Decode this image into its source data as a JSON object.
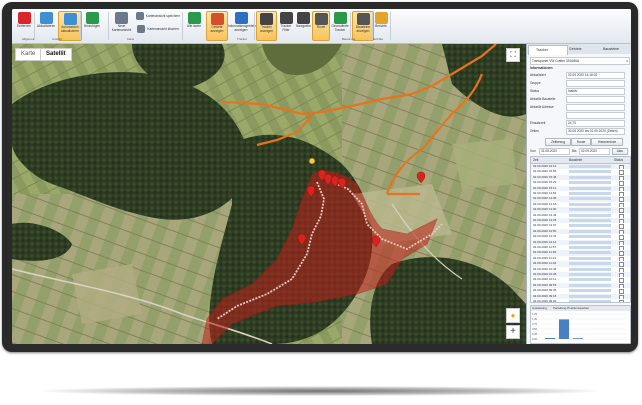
{
  "ribbon": {
    "buttons": [
      {
        "label": "Entfernen",
        "icon": "close-icon",
        "color": "#d8262b",
        "active": false
      },
      {
        "label": "Aktualisieren",
        "icon": "refresh-icon",
        "color": "#3f8fd2",
        "active": false
      },
      {
        "label": "Automatisch aktualisieren",
        "icon": "auto-refresh-icon",
        "color": "#3f8fd2",
        "active": true
      },
      {
        "label": "Hinzufügen",
        "icon": "globe-icon",
        "color": "#2a9a4a",
        "active": false
      },
      {
        "label": "Neue Kartenansicht",
        "icon": "map-view-icon",
        "color": "#6a7a8a",
        "active": false
      },
      {
        "label": "Kartenansicht speichern",
        "icon": "save-view-icon",
        "color": "#6a7a8a",
        "active": false
      },
      {
        "label": "Kartenansicht löschen",
        "icon": "delete-view-icon",
        "color": "#6a7a8a",
        "active": false
      },
      {
        "label": "Alle laden",
        "icon": "globe-small-icon",
        "color": "#2a9a4a",
        "active": false
      },
      {
        "label": "Gebiete anzeigen",
        "icon": "area-icon",
        "color": "#d4502b",
        "active": true
      },
      {
        "label": "Informationsgebiete anzeigen",
        "icon": "info-icon",
        "color": "#2f6fc1",
        "active": false
      },
      {
        "label": "Tracker anzeigen",
        "icon": "tracker-icon",
        "color": "#444444",
        "active": true
      },
      {
        "label": "Tracker Filter",
        "icon": "filter-icon",
        "color": "#444444",
        "active": false
      },
      {
        "label": "Navigation",
        "icon": "navigation-icon",
        "color": "#444444",
        "active": false
      },
      {
        "label": "Route",
        "icon": "route-icon",
        "color": "#555555",
        "active": true
      },
      {
        "label": "Geocodierte Tracker",
        "icon": "geocode-icon",
        "color": "#2a9a4a",
        "active": false
      },
      {
        "label": "Bausteine anzeigen",
        "icon": "blocks-icon",
        "color": "#555555",
        "active": true
      },
      {
        "label": "Berichte",
        "icon": "report-icon",
        "color": "#e2a42a",
        "active": false
      }
    ],
    "groups": [
      "Allgemein",
      "Ansicht",
      "Karte",
      "Tracker",
      "Bausteine",
      "Berichte"
    ]
  },
  "map": {
    "mode_buttons": [
      "Karte",
      "Satellit"
    ],
    "active_mode": "Satellit"
  },
  "panel": {
    "tabs": [
      "Tracker",
      "Gebiete",
      "Bausteine"
    ],
    "selected_tracker": "Transporter VW Crafter 3S1686A",
    "section_title": "Informationen",
    "fields": [
      {
        "label": "Aktualisiert",
        "value": "02.09.2020 14:18:02"
      },
      {
        "label": "Gruppe",
        "value": ""
      },
      {
        "label": "Status",
        "value": "Inaktiv"
      },
      {
        "label": "Aktuelle Baustelle",
        "value": ""
      },
      {
        "label": "Aktuelle Adresse",
        "value": ""
      },
      {
        "label": "",
        "value": ""
      },
      {
        "label": "Einsatzzeit",
        "value": "24,70"
      },
      {
        "label": "Zeiten",
        "value": "30.08.2020 bis 02.09.2020 (Zeiten)"
      }
    ],
    "action_buttons": [
      "Zeitbezug",
      "Route",
      "Historienlinie"
    ],
    "date_from_label": "Von",
    "date_from": "31.08.2020",
    "date_to_label": "Bis",
    "date_to": "02.09.2020",
    "date_apply": "Aktu",
    "table": {
      "headers": [
        "Zeit",
        "Baustelle",
        "Status"
      ],
      "rows": [
        "02.09.2020 16:14",
        "02.09.2020 15:56",
        "02.09.2020 15:46",
        "02.09.2020 15:29",
        "02.09.2020 15:11",
        "02.09.2020 14:53",
        "02.09.2020 14:36",
        "02.09.2020 14:18",
        "02.09.2020 14:00",
        "02.09.2020 13:43",
        "02.09.2020 13:25",
        "02.09.2020 13:07",
        "02.09.2020 12:50",
        "02.09.2020 12:32",
        "02.09.2020 12:14",
        "02.09.2020 11:57",
        "02.09.2020 11:39",
        "02.09.2020 11:21",
        "02.09.2020 11:04",
        "02.09.2020 10:46",
        "02.09.2020 10:28",
        "02.09.2020 10:11",
        "02.09.2020 09:53",
        "02.09.2020 09:35",
        "02.09.2020 09:18",
        "02.09.2020 09:00"
      ]
    },
    "chart_tabs": [
      "Auslastung",
      "Verteilung Positionsquellen"
    ],
    "chart": {
      "yticks": [
        "1,25",
        "1,00",
        "0,75",
        "0,50",
        "0,25",
        "0,00"
      ],
      "bars": [
        0.05,
        0.98,
        0.04
      ],
      "bar_color": "#4a7fc4"
    }
  },
  "map_controls": {
    "zoom_in": "+",
    "zoom_out": "−",
    "fullscreen_icon": "fullscreen-icon",
    "pegman_icon": "pegman-icon"
  }
}
